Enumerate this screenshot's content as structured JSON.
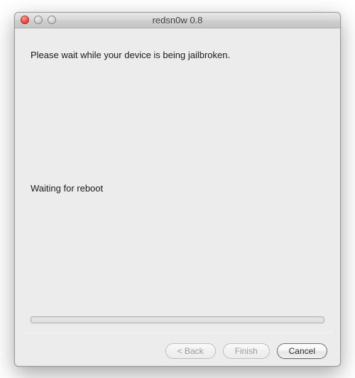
{
  "window": {
    "title": "redsn0w 0.8"
  },
  "content": {
    "instruction": "Please wait while your device is being jailbroken.",
    "status": "Waiting for reboot"
  },
  "buttons": {
    "back": "< Back",
    "finish": "Finish",
    "cancel": "Cancel"
  }
}
